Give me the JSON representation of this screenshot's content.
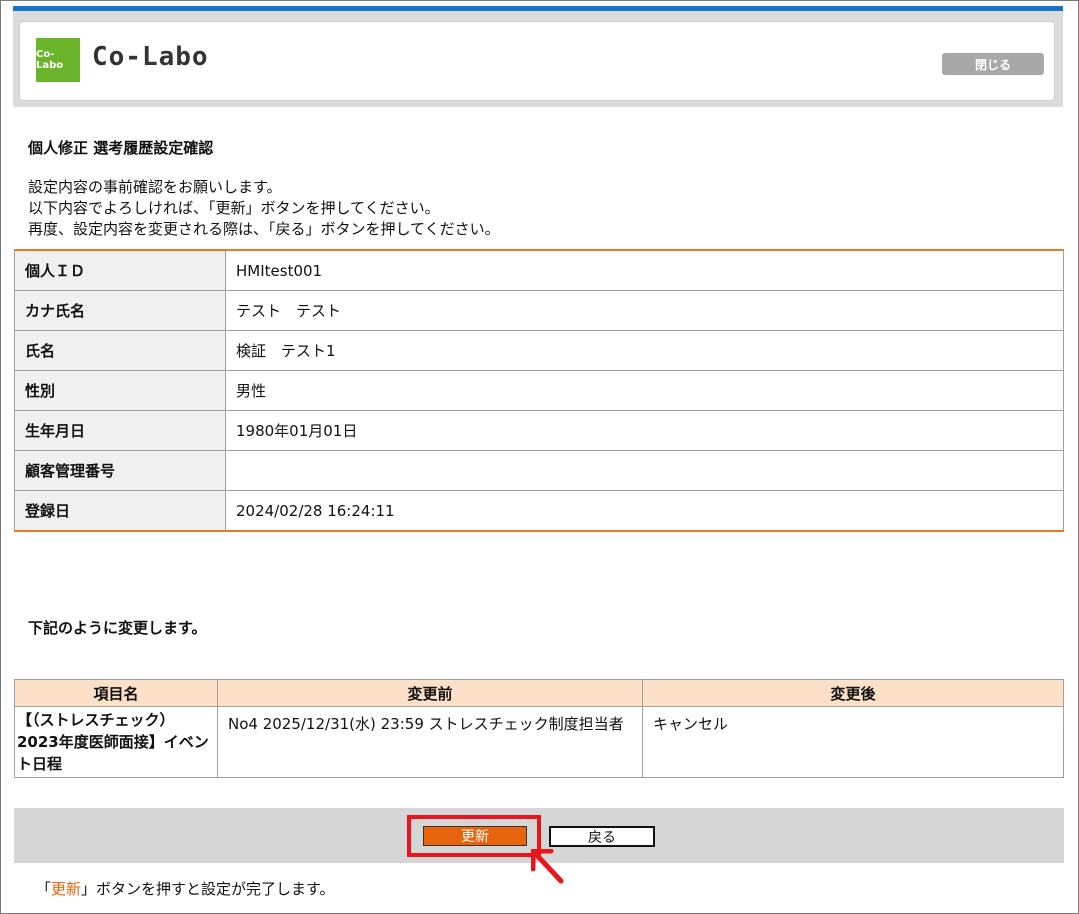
{
  "header": {
    "logo_badge": "Co-Labo",
    "logo_text": "Co-Labo",
    "close_label": "閉じる"
  },
  "page": {
    "title": "個人修正 選考履歴設定確認",
    "intro_lines": [
      "設定内容の事前確認をお願いします。",
      "以下内容でよろしければ、「更新」ボタンを押してください。",
      "再度、設定内容を変更される際は、「戻る」ボタンを押してください。"
    ]
  },
  "info": [
    {
      "label": "個人ＩＤ",
      "value": "HMItest001"
    },
    {
      "label": "カナ氏名",
      "value": "テスト　テスト"
    },
    {
      "label": "氏名",
      "value": "検証　テスト1"
    },
    {
      "label": "性別",
      "value": "男性"
    },
    {
      "label": "生年月日",
      "value": "1980年01月01日"
    },
    {
      "label": "顧客管理番号",
      "value": ""
    },
    {
      "label": "登録日",
      "value": "2024/02/28 16:24:11"
    }
  ],
  "changes": {
    "title": "下記のように変更します。",
    "headers": [
      "項目名",
      "変更前",
      "変更後"
    ],
    "rows": [
      {
        "item": "【（ストレスチェック）2023年度医師面接】イベント日程",
        "before": "No4 2025/12/31(水) 23:59 ストレスチェック制度担当者",
        "after": "キャンセル"
      }
    ]
  },
  "actions": {
    "update_label": "更新",
    "back_label": "戻る"
  },
  "footer": {
    "open_bracket": "「",
    "accent_word": "更新",
    "rest": "」ボタンを押すと設定が完了します。"
  },
  "colors": {
    "accent": "#e8640c",
    "highlight": "#e8141e",
    "header_bar": "#1a73c9",
    "logo_green": "#6ab52b"
  }
}
